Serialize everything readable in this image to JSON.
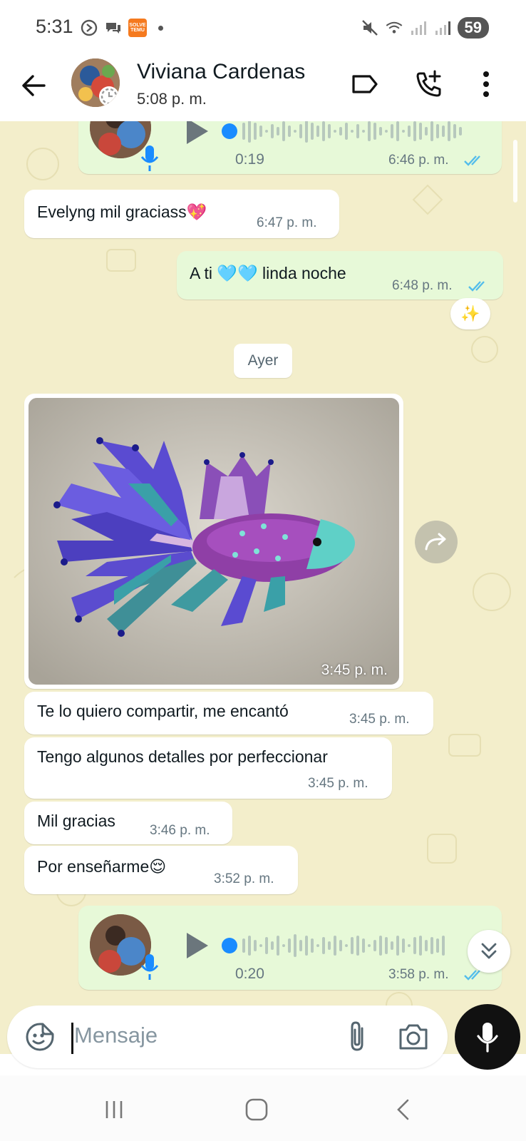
{
  "status_bar": {
    "time": "5:31",
    "battery": "59",
    "temu_label": "SOLVE TEMU"
  },
  "header": {
    "contact_name": "Viviana Cardenas",
    "last_seen": "5:08 p. m."
  },
  "messages": {
    "voice_1": {
      "duration": "0:19",
      "time": "6:46 p. m."
    },
    "m1": {
      "text": "Evelyng mil graciass💖",
      "time": "6:47 p. m."
    },
    "m2": {
      "text": "A ti 🩵🩵 linda noche",
      "time": "6:48 p. m.",
      "reaction": "✨"
    },
    "date_divider": "Ayer",
    "image": {
      "time": "3:45 p. m."
    },
    "m3": {
      "text": "Te lo quiero compartir, me encantó",
      "time": "3:45 p. m."
    },
    "m4": {
      "text": "Tengo algunos detalles por perfeccionar",
      "time": "3:45 p. m."
    },
    "m5": {
      "text": "Mil gracias",
      "time": "3:46 p. m."
    },
    "m6": {
      "text": "Por enseñarme😌",
      "time": "3:52 p. m."
    },
    "voice_2": {
      "duration": "0:20",
      "time": "3:58 p. m."
    }
  },
  "composer": {
    "placeholder": "Mensaje"
  },
  "colors": {
    "chat_bg": "#f3eecb",
    "outgoing_bubble": "#e7f9d8",
    "incoming_bubble": "#ffffff",
    "read_ticks": "#53bdeb",
    "accent": "#1a8cff"
  }
}
